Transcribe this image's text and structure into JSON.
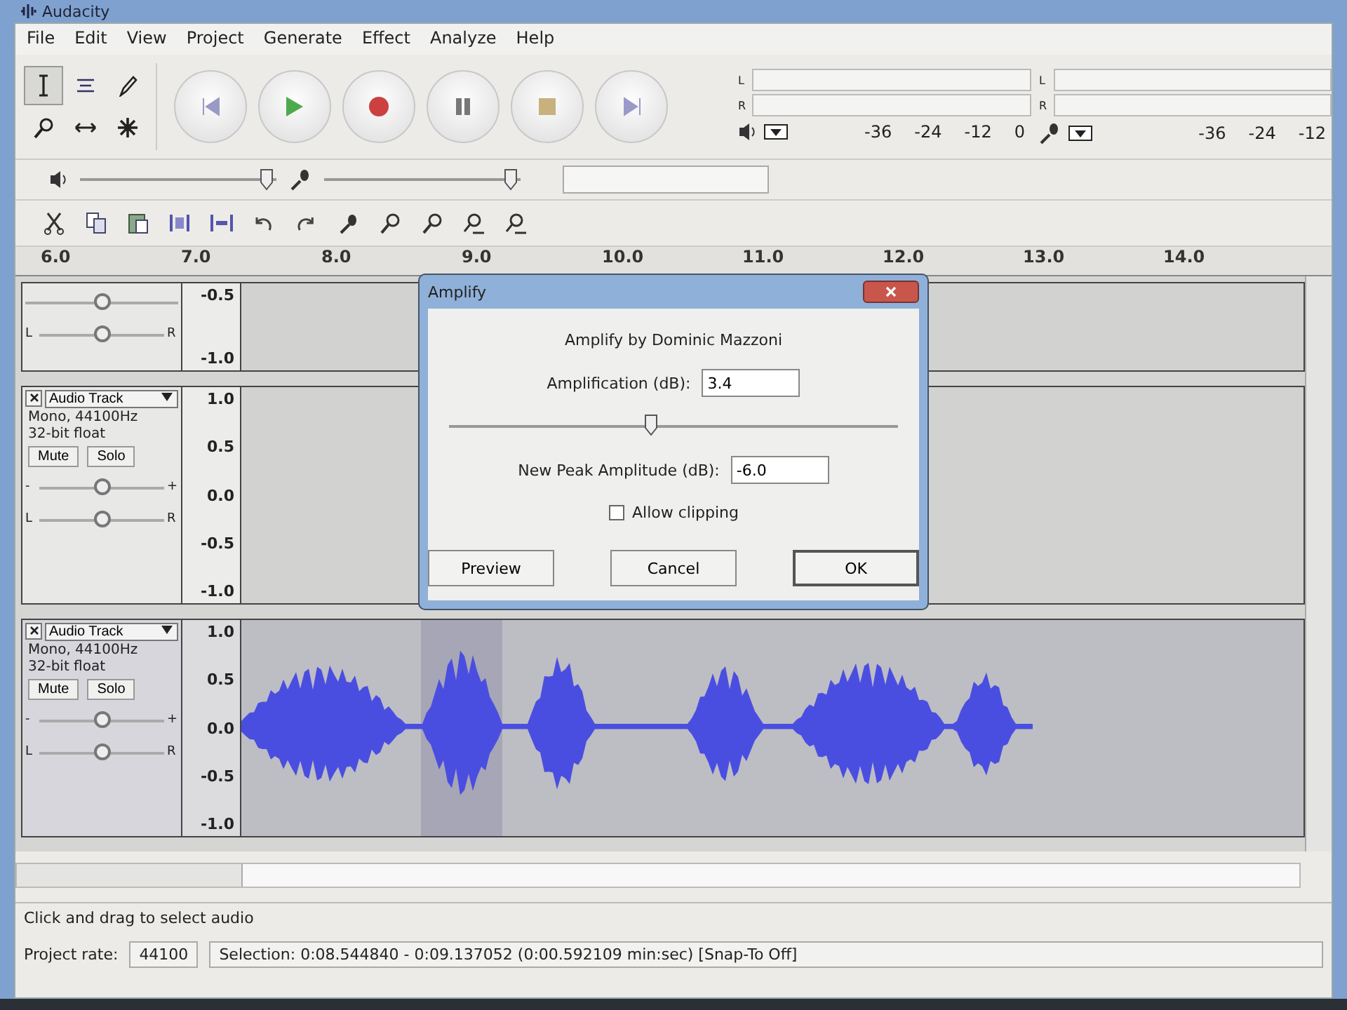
{
  "window": {
    "title": "Audacity"
  },
  "menu": [
    "File",
    "Edit",
    "View",
    "Project",
    "Generate",
    "Effect",
    "Analyze",
    "Help"
  ],
  "tools": [
    {
      "kind": "select",
      "selected": true
    },
    {
      "kind": "envelope",
      "selected": false
    },
    {
      "kind": "draw",
      "selected": false
    },
    {
      "kind": "zoom",
      "selected": false
    },
    {
      "kind": "timeshift",
      "selected": false
    },
    {
      "kind": "multi",
      "selected": false
    }
  ],
  "transport": [
    {
      "kind": "skip-start"
    },
    {
      "kind": "play"
    },
    {
      "kind": "record"
    },
    {
      "kind": "pause"
    },
    {
      "kind": "stop"
    },
    {
      "kind": "skip-end"
    }
  ],
  "meters": [
    {
      "kind": "playback",
      "channels": [
        "L",
        "R"
      ],
      "ticks": [
        "-36",
        "-24",
        "-12",
        "0"
      ]
    },
    {
      "kind": "record",
      "channels": [
        "L",
        "R"
      ],
      "ticks": [
        "-36",
        "-24",
        "-12"
      ]
    }
  ],
  "mixer": {
    "playback": {
      "level": 0.95
    },
    "record": {
      "level": 0.95
    }
  },
  "edit_tools": [
    {
      "kind": "cut"
    },
    {
      "kind": "copy"
    },
    {
      "kind": "paste"
    },
    {
      "kind": "trim"
    },
    {
      "kind": "silence"
    },
    {
      "kind": "undo"
    },
    {
      "kind": "redo"
    },
    {
      "kind": "sync"
    },
    {
      "kind": "zoom-in"
    },
    {
      "kind": "zoom-out"
    },
    {
      "kind": "fit-selection"
    },
    {
      "kind": "fit-project"
    }
  ],
  "ruler": [
    "6.0",
    "7.0",
    "8.0",
    "9.0",
    "10.0",
    "11.0",
    "12.0",
    "13.0",
    "14.0"
  ],
  "tracks": [
    {
      "kind": "clipped",
      "selected": false,
      "scale": [
        "-0.5",
        "-1.0"
      ],
      "gain": {
        "level": 0.5
      },
      "pan": {
        "level": 0.5
      },
      "pan_labels": [
        "L",
        "R"
      ]
    },
    {
      "kind": "full",
      "selected": false,
      "name": "Audio Track",
      "info": [
        "Mono, 44100Hz",
        "32-bit float"
      ],
      "buttons": [
        "Mute",
        "Solo"
      ],
      "gain_labels": [
        "-",
        "+"
      ],
      "pan_labels": [
        "L",
        "R"
      ],
      "gain": {
        "level": 0.5
      },
      "pan": {
        "level": 0.5
      },
      "scale": [
        "1.0",
        "0.5",
        "0.0",
        "-0.5",
        "-1.0"
      ],
      "waveform": false
    },
    {
      "kind": "full",
      "selected": true,
      "name": "Audio Track",
      "info": [
        "Mono, 44100Hz",
        "32-bit float"
      ],
      "buttons": [
        "Mute",
        "Solo"
      ],
      "gain_labels": [
        "-",
        "+"
      ],
      "pan_labels": [
        "L",
        "R"
      ],
      "gain": {
        "level": 0.5
      },
      "pan": {
        "level": 0.5
      },
      "scale": [
        "1.0",
        "0.5",
        "0.0",
        "-0.5",
        "-1.0"
      ],
      "waveform": true
    }
  ],
  "status_bar": {
    "message": "Click and drag to select audio",
    "rate_label": "Project rate:",
    "rate": "44100",
    "selection": "Selection: 0:08.544840 - 0:09.137052 (0:00.592109 min:sec)  [Snap-To Off]"
  },
  "dialog": {
    "title": "Amplify",
    "heading": "Amplify by Dominic Mazzoni",
    "amplification_label": "Amplification (dB):",
    "amplification": "3.4",
    "slider": {
      "level": 0.45
    },
    "peak_label": "New Peak Amplitude (dB):",
    "peak": "-6.0",
    "allow_clipping": {
      "label": "Allow clipping",
      "checked": false
    },
    "buttons": [
      {
        "label": "Preview",
        "default": false
      },
      {
        "label": "Cancel",
        "default": false
      },
      {
        "label": "OK",
        "default": true
      }
    ]
  }
}
